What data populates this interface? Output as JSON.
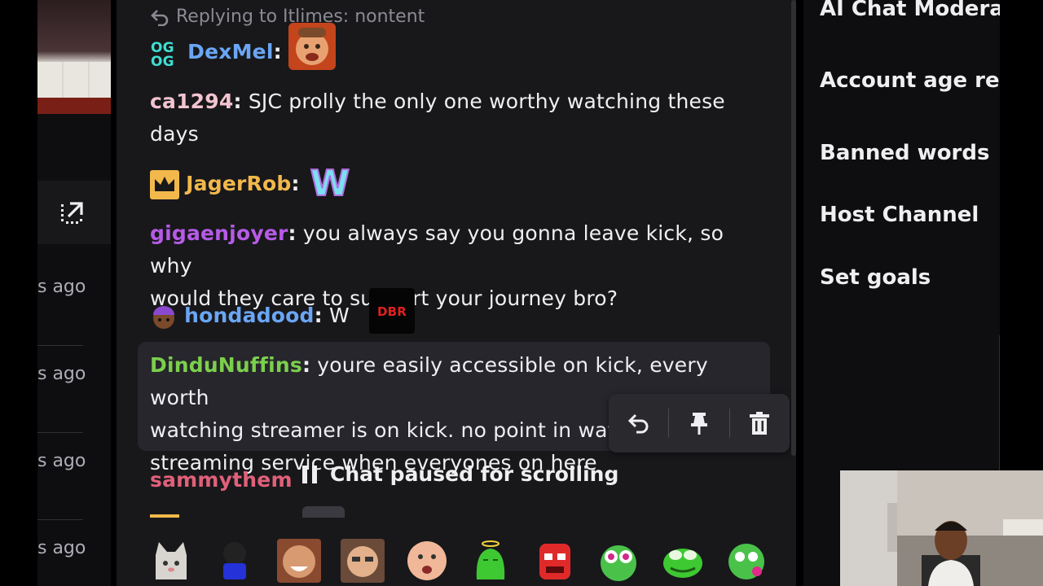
{
  "left_panel": {
    "ago_items": [
      "s ago",
      "s ago",
      "s ago",
      "s ago"
    ],
    "popout_icon": "popout-arrow-icon"
  },
  "chat": {
    "reply_hint": "Replying to Itlimes: nontent",
    "messages": [
      {
        "user": "DexMel",
        "sep": ":",
        "text": "",
        "user_color": "#6aa6f4"
      },
      {
        "user": "ca1294",
        "sep": ":",
        "text": " SJC prolly the only one worthy watching these",
        "text2": "days",
        "user_color": "#f2c4cf"
      },
      {
        "user": "JagerRob",
        "sep": ":",
        "text": "",
        "user_color": "#f2b84b"
      },
      {
        "user": "gigaenjoyer",
        "sep": ":",
        "text": " you always say you gonna leave kick, so why",
        "text2": "would they care to support your journey bro?",
        "user_color": "#b65be6"
      },
      {
        "user": "hondadood",
        "sep": ":",
        "text": " W",
        "user_color": "#6aa6f4"
      },
      {
        "user": "DinduNuffins",
        "sep": ":",
        "text": " youre easily accessible on kick, every worth",
        "text2": "watching streamer is on kick. no point in watc",
        "text3": "streaming service when everyones on here",
        "user_color": "#7ccf4c"
      },
      {
        "user": "sammythem",
        "user_color": "#e0607a"
      }
    ],
    "emotes": {
      "dbr_label": "DBR"
    },
    "paused_text": "Chat paused for scrolling",
    "actions": [
      "reply-icon",
      "pin-icon",
      "trash-icon"
    ]
  },
  "right_menu": {
    "items": [
      "AI Chat Moderat",
      "Account age res",
      "Banned words",
      "Host Channel",
      "Set goals"
    ]
  },
  "colors": {
    "panel": "#18181b",
    "highlight": "#26262c",
    "menu_bg": "#0e0e10"
  }
}
